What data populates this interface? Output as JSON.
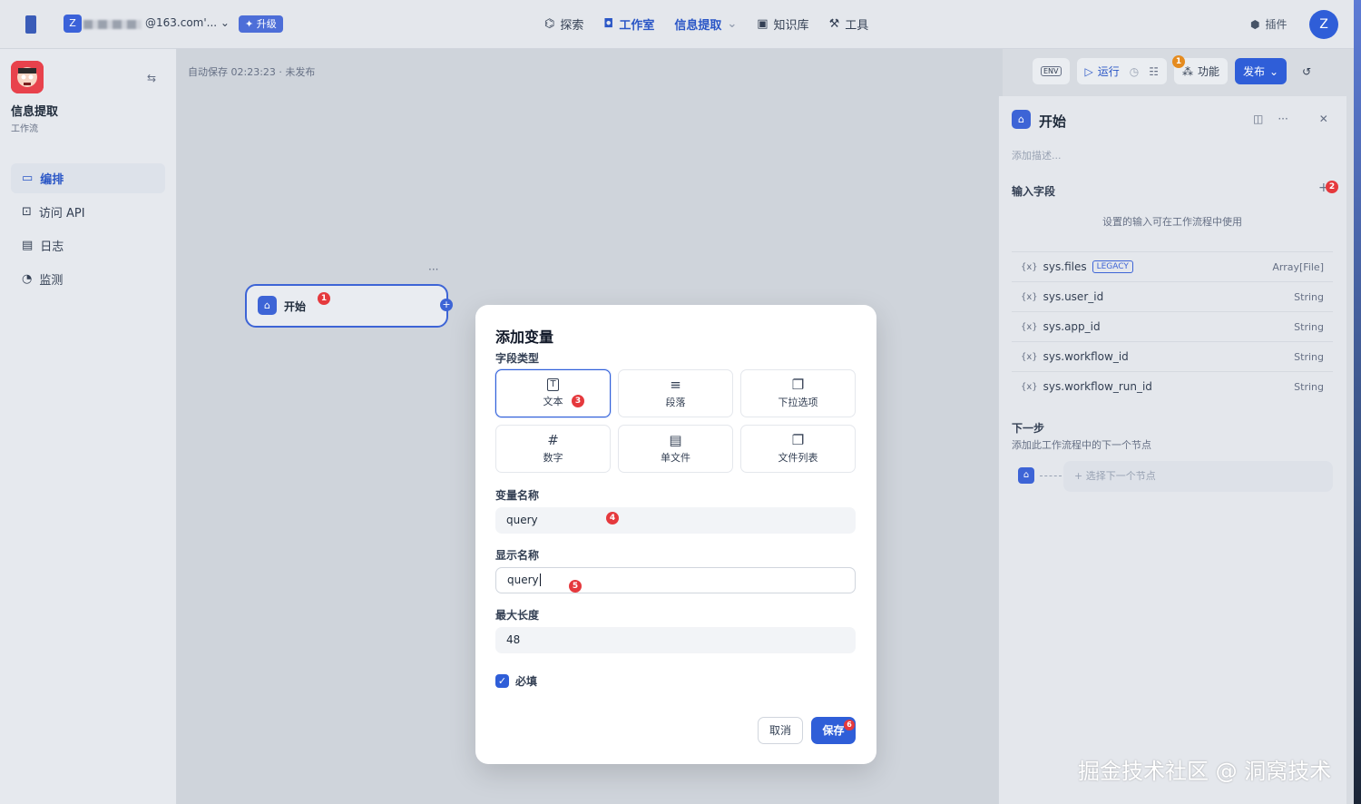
{
  "topbar": {
    "workspace_initial": "Z",
    "workspace_email": "@163.com'...",
    "upgrade_label": "✦ 升级",
    "nav": [
      {
        "label": "探索"
      },
      {
        "label": "工作室"
      },
      {
        "label": "信息提取"
      },
      {
        "label": "知识库"
      },
      {
        "label": "工具"
      }
    ],
    "plugins_label": "插件",
    "user_initial": "Z"
  },
  "sidebar": {
    "app_title": "信息提取",
    "app_type": "工作流",
    "items": [
      {
        "label": "编排"
      },
      {
        "label": "访问 API"
      },
      {
        "label": "日志"
      },
      {
        "label": "监测"
      }
    ]
  },
  "canvas": {
    "autosave": "自动保存 02:23:23 · 未发布",
    "node_title": "开始",
    "node_more": "···"
  },
  "toolbar": {
    "env_label": "ENV",
    "run_label": "运行",
    "features_label": "功能",
    "publish_label": "发布"
  },
  "panel": {
    "title": "开始",
    "desc_placeholder": "添加描述...",
    "input_fields_label": "输入字段",
    "hint": "设置的输入可在工作流程中使用",
    "variables": [
      {
        "name": "sys.files",
        "tag": "LEGACY",
        "type": "Array[File]"
      },
      {
        "name": "sys.user_id",
        "tag": "",
        "type": "String"
      },
      {
        "name": "sys.app_id",
        "tag": "",
        "type": "String"
      },
      {
        "name": "sys.workflow_id",
        "tag": "",
        "type": "String"
      },
      {
        "name": "sys.workflow_run_id",
        "tag": "",
        "type": "String"
      }
    ],
    "var_prefix": "{x}",
    "next_title": "下一步",
    "next_desc": "添加此工作流程中的下一个节点",
    "next_select": "+ 选择下一个节点"
  },
  "modal": {
    "title": "添加变量",
    "field_type_label": "字段类型",
    "types": [
      {
        "label": "文本",
        "icon": "T"
      },
      {
        "label": "段落",
        "icon": "≡"
      },
      {
        "label": "下拉选项",
        "icon": "❐"
      },
      {
        "label": "数字",
        "icon": "#"
      },
      {
        "label": "单文件",
        "icon": "▤"
      },
      {
        "label": "文件列表",
        "icon": "❐"
      }
    ],
    "var_name_label": "变量名称",
    "var_name_value": "query",
    "display_name_label": "显示名称",
    "display_name_value": "query",
    "max_length_label": "最大长度",
    "max_length_value": "48",
    "required_label": "必填",
    "cancel_label": "取消",
    "save_label": "保存"
  },
  "badges": {
    "b1": "1",
    "b2": "2",
    "b3": "3",
    "b4": "4",
    "b5": "5",
    "b6": "6",
    "b_bell": "1"
  },
  "watermark": "掘金技术社区 @ 洞窝技术",
  "colors": {
    "accent": "#2f5ed8",
    "badge": "#e5393d"
  }
}
